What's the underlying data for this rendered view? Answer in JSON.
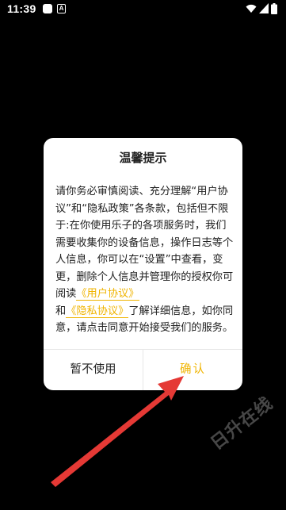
{
  "status_bar": {
    "time": "11:39",
    "notification_a": "A",
    "icons": [
      "notification-square-icon",
      "notification-a-icon",
      "wifi-icon",
      "signal-icon",
      "battery-icon"
    ]
  },
  "dialog": {
    "title": "温馨提示",
    "body_text_1": "请你务必审慎阅读、充分理解“用户协议”和“隐私政策”各条款，包括但不限于:在你使用乐子的各项服务时，我们需要收集你的设备信息，操作日志等个人信息，你可以在“设置”中查看，变更，删除个人信息并管理你的授权你可阅读",
    "user_agreement_link": "《用户协议》",
    "body_text_2": "和",
    "privacy_link": "《隐私协议》",
    "body_text_3": "了解详细信息，如你同意，请点击同意开始接受我们的服务。",
    "decline_label": "暂不使用",
    "confirm_label": "确认"
  },
  "watermark": "日升在线",
  "colors": {
    "background": "#000000",
    "dialog_bg": "#ffffff",
    "accent": "#f0b400",
    "arrow": "#e53935"
  }
}
